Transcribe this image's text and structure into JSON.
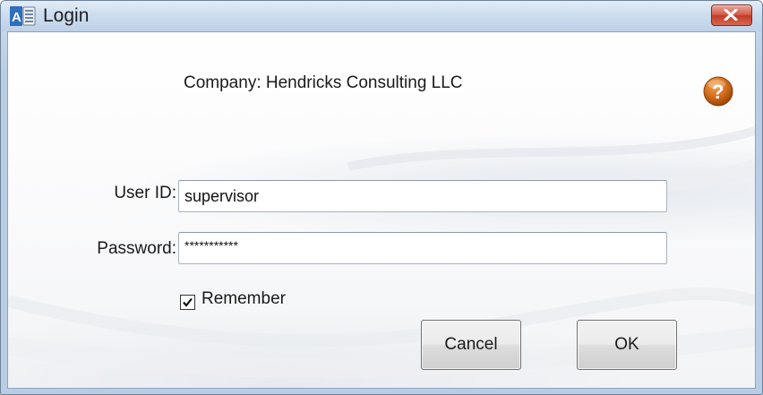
{
  "window": {
    "title": "Login",
    "app_icon": "address-book-icon",
    "close_icon": "close-icon"
  },
  "company": {
    "label": "Company: Hendricks Consulting LLC"
  },
  "help": {
    "icon": "help-icon"
  },
  "form": {
    "userid_label": "User ID:",
    "userid_value": "supervisor",
    "password_label": "Password:",
    "password_value": "***********",
    "remember_label": "Remember",
    "remember_checked": true
  },
  "buttons": {
    "cancel_label": "Cancel",
    "ok_label": "OK"
  },
  "colors": {
    "close_red": "#c9452f",
    "help_orange": "#d06a1a",
    "frame_blue": "#c3d5ea"
  }
}
